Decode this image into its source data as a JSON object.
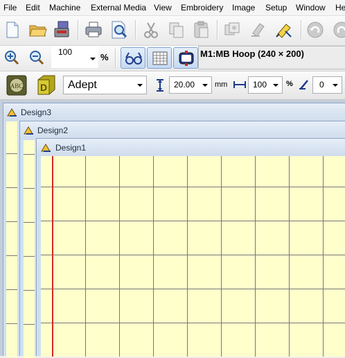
{
  "menu": [
    "File",
    "Edit",
    "Machine",
    "External Media",
    "View",
    "Embroidery",
    "Image",
    "Setup",
    "Window",
    "He"
  ],
  "toolbar": {
    "zoom_value": "100",
    "zoom_unit": "%",
    "hoop_label": "M1:MB Hoop (240 × 200)"
  },
  "text_toolbar": {
    "font": "Adept",
    "size_value": "20.00",
    "size_unit": "mm",
    "width_value": "100",
    "width_unit": "%",
    "slant_value": "0"
  },
  "windows": {
    "design3": "Design3",
    "design2": "Design2",
    "design1": "Design1"
  },
  "colors": {
    "canvas": "#ffffcc",
    "grid": "#777777",
    "needle_line": "#d62b1e",
    "mdi_background": "#c5cedb"
  },
  "icons": [
    "new-icon",
    "open-icon",
    "save-icon",
    "print-icon",
    "print-preview-icon",
    "cut-icon",
    "copy-icon",
    "paste-icon",
    "duplicate-icon",
    "delete-icon",
    "select-icon",
    "undo-icon",
    "redo-icon",
    "zoom-in-icon",
    "zoom-out-icon",
    "realistic-view-icon",
    "grid-icon",
    "hoop-icon",
    "monogram-icon",
    "3d-letter-icon",
    "height-icon",
    "width-icon",
    "slant-icon"
  ]
}
